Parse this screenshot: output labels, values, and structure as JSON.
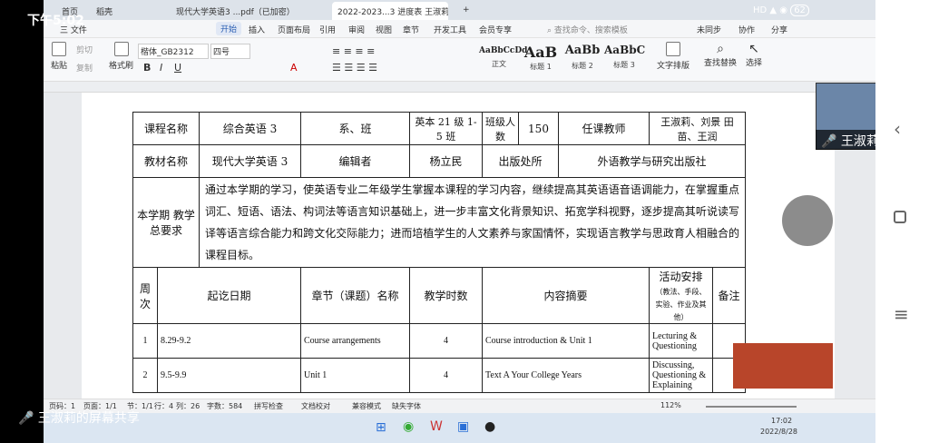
{
  "status_bar": {
    "time": "下午5:02",
    "network": "HD",
    "battery": "62"
  },
  "tabs": [
    {
      "label": "首页"
    },
    {
      "label": "稻壳"
    },
    {
      "label": "现代大学英语3 ...pdf（已加密）"
    },
    {
      "label": "2022-2023...3 进度表 王淑莉"
    },
    {
      "label": "+"
    }
  ],
  "menu": {
    "file": "三 文件",
    "items": [
      "开始",
      "插入",
      "页面布局",
      "引用",
      "审阅",
      "视图",
      "章节",
      "开发工具",
      "会员专享"
    ],
    "search_placeholder": "查找命令、搜索模板",
    "unsynced": "未同步",
    "collab": "协作",
    "share": "分享"
  },
  "ribbon": {
    "paste": "粘贴",
    "cut": "剪切",
    "copy": "复制",
    "format_painter": "格式刷",
    "font_name": "楷体_GB2312",
    "font_size": "四号",
    "styles": [
      {
        "sample": "AaBbCcDd",
        "label": "正文"
      },
      {
        "sample": "AaB",
        "label": "标题 1"
      },
      {
        "sample": "AaBb",
        "label": "标题 2"
      },
      {
        "sample": "AaBbC",
        "label": "标题 3"
      }
    ],
    "text_layout": "文字排版",
    "find_replace": "查找替换",
    "select": "选择"
  },
  "table": {
    "row1": {
      "course_name_label": "课程名称",
      "course_name": "综合英语 3",
      "dept_label": "系、班",
      "class": "英本 21 级 1-5 班",
      "students_label": "班级人数",
      "students": "150",
      "teacher_label": "任课教师",
      "teachers": "王淑莉、刘景 田苗、王润"
    },
    "row2": {
      "textbook_label": "教材名称",
      "textbook": "现代大学英语 3",
      "editor_label": "编辑者",
      "editor": "杨立民",
      "publisher_label": "出版处所",
      "publisher": "外语教学与研究出版社"
    },
    "requirements_label": "本学期 教学总要求",
    "requirements": "通过本学期的学习，使英语专业二年级学生掌握本课程的学习内容，继续提高其英语语音语调能力，在掌握重点词汇、短语、语法、构词法等语言知识基础上，进一步丰富文化背景知识、拓宽学科视野，逐步提高其听说读写译等语言综合能力和跨文化交际能力；进而培植学生的人文素养与家国情怀，实现语言教学与思政育人相融合的课程目标。",
    "headers": {
      "week": "周次",
      "dates": "起讫日期",
      "chapter": "章节（课题）名称",
      "hours": "教学时数",
      "summary": "内容摘要",
      "activities": "活动安排",
      "activities_sub": "（教法、手段、实验、作业及其他）",
      "notes": "备注"
    },
    "rows": [
      {
        "week": "1",
        "dates": "8.29-9.2",
        "chapter": "Course arrangements",
        "hours": "4",
        "summary": "Course introduction & Unit 1",
        "activities": "Lecturing & Questioning",
        "notes": ""
      },
      {
        "week": "2",
        "dates": "9.5-9.9",
        "chapter": "Unit 1",
        "hours": "4",
        "summary": "Text A Your College Years",
        "activities": "Discussing, Questioning & Explaining",
        "notes": ""
      }
    ]
  },
  "status": {
    "page": "页码：1",
    "pages": "页面：1/1",
    "section": "节：1/1",
    "row": "行：4",
    "col": "列：26",
    "words": "字数：584",
    "spell": "拼写检查",
    "proof": "文档校对",
    "compat": "兼容模式",
    "missing_font": "缺失字体",
    "zoom": "112%"
  },
  "taskbar": {
    "time": "17:02",
    "date": "2022/8/28"
  },
  "overlay": {
    "presenter_name": "王淑莉",
    "share_label": "王淑莉的屏幕共享"
  },
  "colors": {
    "accent": "#2b5fb3",
    "tab_bg": "#dde3ea",
    "ribbon_bg": "#f7f8fa"
  }
}
